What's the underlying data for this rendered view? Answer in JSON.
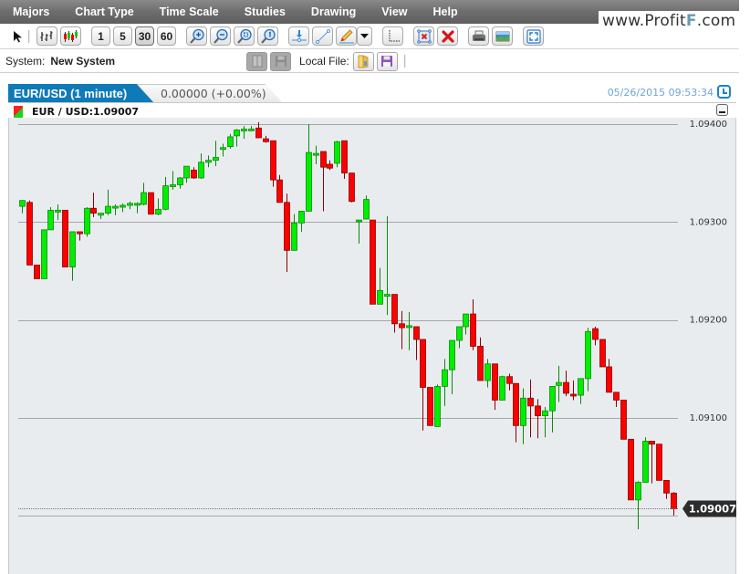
{
  "menu": {
    "items": [
      "Majors",
      "Chart Type",
      "Time Scale",
      "Studies",
      "Drawing",
      "View",
      "Help"
    ]
  },
  "watermark": {
    "prefix": "www.Profit",
    "letter": "F",
    "suffix": ".com"
  },
  "toolbar": {
    "pointer_icon": "arrow-cursor-icon",
    "chart_types": [
      {
        "name": "bar-chart-type",
        "icon": "ohlc-bars-icon"
      },
      {
        "name": "candle-chart-type",
        "icon": "candlestick-icon"
      }
    ],
    "time_scales": [
      "1",
      "5",
      "30",
      "60"
    ],
    "selected_time_scale": "30",
    "zoom_buttons": [
      {
        "name": "zoom-in",
        "icon": "zoom-in-icon",
        "glyph": "+"
      },
      {
        "name": "zoom-out",
        "icon": "zoom-out-icon",
        "glyph": "−"
      },
      {
        "name": "zoom-fit",
        "icon": "zoom-fit-icon",
        "glyph": "▫"
      },
      {
        "name": "zoom-reset",
        "icon": "zoom-reset-icon",
        "glyph": "1"
      }
    ],
    "drawing_buttons": [
      {
        "name": "horizontal-line",
        "icon": "horizontal-line-icon"
      },
      {
        "name": "trend-line",
        "icon": "trend-line-icon"
      },
      {
        "name": "pencil",
        "icon": "pencil-icon"
      }
    ],
    "other_buttons": [
      {
        "name": "crosshair",
        "icon": "crosshair-icon"
      },
      {
        "name": "delete-selected",
        "icon": "delete-selected-icon"
      },
      {
        "name": "delete-all",
        "icon": "delete-all-icon"
      },
      {
        "name": "print",
        "icon": "printer-icon"
      },
      {
        "name": "save-image",
        "icon": "image-icon"
      },
      {
        "name": "fullscreen",
        "icon": "fullscreen-icon"
      }
    ]
  },
  "system": {
    "label": "System:",
    "value": "New System",
    "local_file_label": "Local File:"
  },
  "tabs": {
    "active": "EUR/USD (1 minute)",
    "change": "0.00000 (+0.00%)"
  },
  "timestamp": "05/26/2015 09:53:34",
  "legend": {
    "text": "EUR / USD:1.09007"
  },
  "colors": {
    "up": "#00ee00",
    "up_border": "#0a8a0a",
    "down": "#ff0000",
    "down_border": "#8b0000",
    "grid": "#a6a6a6",
    "tab_active": "#0f7ab8",
    "timestamp": "#6fa6d9"
  },
  "chart_data": {
    "type": "candlestick",
    "symbol": "EUR/USD",
    "interval": "1 minute",
    "last_price": "1.09007",
    "y_ticks": [
      "1.09400",
      "1.09300",
      "1.09200",
      "1.09100"
    ],
    "ylim": [
      1.08956,
      1.09405
    ],
    "gridlines": [
      1.094,
      1.093,
      1.092,
      1.091,
      1.09
    ],
    "candles": [
      {
        "o": 1.09316,
        "h": 1.09317,
        "l": 1.09309,
        "c": 1.09322
      },
      {
        "o": 1.0932,
        "h": 1.09322,
        "l": 1.09276,
        "c": 1.09256
      },
      {
        "o": 1.09256,
        "h": 1.09256,
        "l": 1.09242,
        "c": 1.09242
      },
      {
        "o": 1.09242,
        "h": 1.09292,
        "l": 1.09242,
        "c": 1.09292
      },
      {
        "o": 1.09292,
        "h": 1.09315,
        "l": 1.09292,
        "c": 1.09312
      },
      {
        "o": 1.09312,
        "h": 1.09318,
        "l": 1.09302,
        "c": 1.09312
      },
      {
        "o": 1.09312,
        "h": 1.09312,
        "l": 1.09254,
        "c": 1.09254
      },
      {
        "o": 1.09254,
        "h": 1.0929,
        "l": 1.0924,
        "c": 1.0929
      },
      {
        "o": 1.0929,
        "h": 1.0929,
        "l": 1.09281,
        "c": 1.09288
      },
      {
        "o": 1.09288,
        "h": 1.09315,
        "l": 1.09285,
        "c": 1.09314
      },
      {
        "o": 1.09314,
        "h": 1.0933,
        "l": 1.09305,
        "c": 1.09309
      },
      {
        "o": 1.09307,
        "h": 1.09309,
        "l": 1.09303,
        "c": 1.09309
      },
      {
        "o": 1.09309,
        "h": 1.09333,
        "l": 1.09307,
        "c": 1.09316
      },
      {
        "o": 1.09316,
        "h": 1.09318,
        "l": 1.09307,
        "c": 1.09316
      },
      {
        "o": 1.09317,
        "h": 1.09319,
        "l": 1.0931,
        "c": 1.09317
      },
      {
        "o": 1.09317,
        "h": 1.09321,
        "l": 1.09313,
        "c": 1.09319
      },
      {
        "o": 1.09319,
        "h": 1.0932,
        "l": 1.09309,
        "c": 1.09319
      },
      {
        "o": 1.09318,
        "h": 1.0934,
        "l": 1.09317,
        "c": 1.0933
      },
      {
        "o": 1.0933,
        "h": 1.0933,
        "l": 1.09308,
        "c": 1.09308
      },
      {
        "o": 1.09308,
        "h": 1.09324,
        "l": 1.09307,
        "c": 1.09313
      },
      {
        "o": 1.09313,
        "h": 1.09346,
        "l": 1.09312,
        "c": 1.09337
      },
      {
        "o": 1.09337,
        "h": 1.09352,
        "l": 1.09333,
        "c": 1.09338
      },
      {
        "o": 1.09338,
        "h": 1.09346,
        "l": 1.09334,
        "c": 1.09345
      },
      {
        "o": 1.09345,
        "h": 1.09346,
        "l": 1.0934,
        "c": 1.09357
      },
      {
        "o": 1.09353,
        "h": 1.09356,
        "l": 1.09344,
        "c": 1.09345
      },
      {
        "o": 1.09345,
        "h": 1.0937,
        "l": 1.09344,
        "c": 1.09361
      },
      {
        "o": 1.09361,
        "h": 1.09368,
        "l": 1.09356,
        "c": 1.09363
      },
      {
        "o": 1.09363,
        "h": 1.09383,
        "l": 1.09357,
        "c": 1.09366
      },
      {
        "o": 1.09376,
        "h": 1.0938,
        "l": 1.09367,
        "c": 1.09376
      },
      {
        "o": 1.09377,
        "h": 1.0939,
        "l": 1.09375,
        "c": 1.09387
      },
      {
        "o": 1.09388,
        "h": 1.09395,
        "l": 1.09377,
        "c": 1.09394
      },
      {
        "o": 1.09393,
        "h": 1.09398,
        "l": 1.09385,
        "c": 1.09395
      },
      {
        "o": 1.09395,
        "h": 1.09398,
        "l": 1.09394,
        "c": 1.09395
      },
      {
        "o": 1.09396,
        "h": 1.09402,
        "l": 1.09386,
        "c": 1.09386
      },
      {
        "o": 1.09385,
        "h": 1.09388,
        "l": 1.09381,
        "c": 1.09382
      },
      {
        "o": 1.09383,
        "h": 1.09383,
        "l": 1.09336,
        "c": 1.09343
      },
      {
        "o": 1.09343,
        "h": 1.09348,
        "l": 1.09333,
        "c": 1.0932
      },
      {
        "o": 1.0932,
        "h": 1.09329,
        "l": 1.09249,
        "c": 1.09271
      },
      {
        "o": 1.09271,
        "h": 1.09308,
        "l": 1.09271,
        "c": 1.09299
      },
      {
        "o": 1.09299,
        "h": 1.0931,
        "l": 1.0929,
        "c": 1.09311
      },
      {
        "o": 1.09311,
        "h": 1.094,
        "l": 1.09311,
        "c": 1.09371
      },
      {
        "o": 1.0937,
        "h": 1.09378,
        "l": 1.09359,
        "c": 1.0937
      },
      {
        "o": 1.09372,
        "h": 1.09372,
        "l": 1.09311,
        "c": 1.09356
      },
      {
        "o": 1.09359,
        "h": 1.09363,
        "l": 1.09353,
        "c": 1.09355
      },
      {
        "o": 1.0936,
        "h": 1.09383,
        "l": 1.09356,
        "c": 1.09382
      },
      {
        "o": 1.09383,
        "h": 1.09383,
        "l": 1.09344,
        "c": 1.0935
      },
      {
        "o": 1.0935,
        "h": 1.0935,
        "l": 1.0932,
        "c": 1.09321
      },
      {
        "o": 1.09302,
        "h": 1.09302,
        "l": 1.09278,
        "c": 1.09302
      },
      {
        "o": 1.09303,
        "h": 1.09327,
        "l": 1.09303,
        "c": 1.09323
      },
      {
        "o": 1.09302,
        "h": 1.09302,
        "l": 1.09217,
        "c": 1.09216
      },
      {
        "o": 1.09216,
        "h": 1.09253,
        "l": 1.09219,
        "c": 1.0923
      },
      {
        "o": 1.09226,
        "h": 1.09306,
        "l": 1.09205,
        "c": 1.09226
      },
      {
        "o": 1.09226,
        "h": 1.09196,
        "l": 1.09187,
        "c": 1.09196
      },
      {
        "o": 1.09196,
        "h": 1.09209,
        "l": 1.0917,
        "c": 1.09192
      },
      {
        "o": 1.09194,
        "h": 1.09208,
        "l": 1.09169,
        "c": 1.09194
      },
      {
        "o": 1.09193,
        "h": 1.09193,
        "l": 1.09159,
        "c": 1.0918
      },
      {
        "o": 1.0918,
        "h": 1.0918,
        "l": 1.09087,
        "c": 1.09131
      },
      {
        "o": 1.09131,
        "h": 1.09131,
        "l": 1.09093,
        "c": 1.09092
      },
      {
        "o": 1.09091,
        "h": 1.09134,
        "l": 1.09107,
        "c": 1.09132
      },
      {
        "o": 1.09132,
        "h": 1.0916,
        "l": 1.09112,
        "c": 1.09149
      },
      {
        "o": 1.09149,
        "h": 1.09172,
        "l": 1.09124,
        "c": 1.09179
      },
      {
        "o": 1.09179,
        "h": 1.09191,
        "l": 1.09171,
        "c": 1.09193
      },
      {
        "o": 1.09193,
        "h": 1.09201,
        "l": 1.09185,
        "c": 1.09206
      },
      {
        "o": 1.09206,
        "h": 1.09221,
        "l": 1.09169,
        "c": 1.09173
      },
      {
        "o": 1.09173,
        "h": 1.09182,
        "l": 1.0915,
        "c": 1.09138
      },
      {
        "o": 1.09138,
        "h": 1.0916,
        "l": 1.09131,
        "c": 1.09155
      },
      {
        "o": 1.09155,
        "h": 1.09155,
        "l": 1.09108,
        "c": 1.09118
      },
      {
        "o": 1.09118,
        "h": 1.09143,
        "l": 1.09125,
        "c": 1.09142
      },
      {
        "o": 1.09142,
        "h": 1.09145,
        "l": 1.09128,
        "c": 1.09135
      },
      {
        "o": 1.09135,
        "h": 1.09135,
        "l": 1.09075,
        "c": 1.09092
      },
      {
        "o": 1.09092,
        "h": 1.0913,
        "l": 1.09073,
        "c": 1.0912
      },
      {
        "o": 1.0912,
        "h": 1.09139,
        "l": 1.0908,
        "c": 1.09112
      },
      {
        "o": 1.09112,
        "h": 1.09119,
        "l": 1.09079,
        "c": 1.09102
      },
      {
        "o": 1.09102,
        "h": 1.09111,
        "l": 1.0908,
        "c": 1.09107
      },
      {
        "o": 1.09107,
        "h": 1.09131,
        "l": 1.09085,
        "c": 1.09132
      },
      {
        "o": 1.09133,
        "h": 1.09153,
        "l": 1.09116,
        "c": 1.09136
      },
      {
        "o": 1.09136,
        "h": 1.09148,
        "l": 1.09122,
        "c": 1.09125
      },
      {
        "o": 1.09124,
        "h": 1.09138,
        "l": 1.09118,
        "c": 1.09123
      },
      {
        "o": 1.09123,
        "h": 1.09139,
        "l": 1.09114,
        "c": 1.0914
      },
      {
        "o": 1.0914,
        "h": 1.09192,
        "l": 1.09127,
        "c": 1.09188
      },
      {
        "o": 1.09191,
        "h": 1.09193,
        "l": 1.09174,
        "c": 1.0918
      },
      {
        "o": 1.0918,
        "h": 1.0918,
        "l": 1.09158,
        "c": 1.09152
      },
      {
        "o": 1.09152,
        "h": 1.0916,
        "l": 1.0913,
        "c": 1.09126
      },
      {
        "o": 1.09126,
        "h": 1.09126,
        "l": 1.09111,
        "c": 1.09118
      },
      {
        "o": 1.09118,
        "h": 1.09118,
        "l": 1.0909,
        "c": 1.09078
      },
      {
        "o": 1.09078,
        "h": 1.09078,
        "l": 1.09034,
        "c": 1.09016
      },
      {
        "o": 1.09016,
        "h": 1.09035,
        "l": 1.08986,
        "c": 1.09034
      },
      {
        "o": 1.09034,
        "h": 1.0908,
        "l": 1.09034,
        "c": 1.09076
      },
      {
        "o": 1.09076,
        "h": 1.09076,
        "l": 1.09033,
        "c": 1.09073
      },
      {
        "o": 1.09073,
        "h": 1.09073,
        "l": 1.09036,
        "c": 1.09036
      },
      {
        "o": 1.09036,
        "h": 1.09036,
        "l": 1.09017,
        "c": 1.09023
      },
      {
        "o": 1.09023,
        "h": 1.09024,
        "l": 1.09,
        "c": 1.09007
      }
    ]
  }
}
